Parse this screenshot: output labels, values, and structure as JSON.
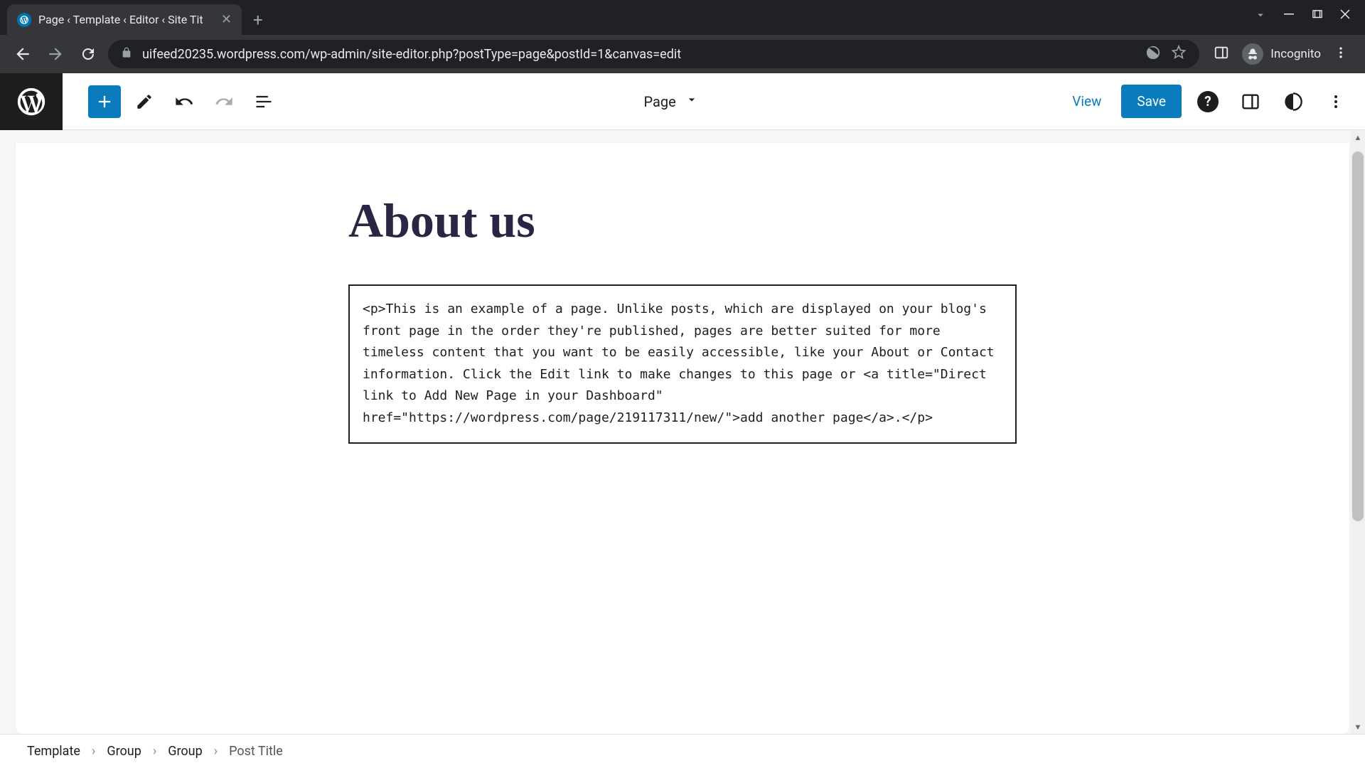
{
  "browser": {
    "tab_title": "Page ‹ Template ‹ Editor ‹ Site Tit",
    "url": "uifeed20235.wordpress.com/wp-admin/site-editor.php?postType=page&postId=1&canvas=edit",
    "incognito_label": "Incognito"
  },
  "toolbar": {
    "page_label": "Page",
    "view_label": "View",
    "save_label": "Save"
  },
  "content": {
    "title": "About us",
    "html_block": "<p>This is an example of a page. Unlike posts, which are displayed on your blog's front page in the order they're published, pages are better suited for more timeless content that you want to be easily accessible, like your About or Contact information. Click the Edit link to make changes to this page or <a title=\"Direct link to Add New Page in your Dashboard\" href=\"https://wordpress.com/page/219117311/new/\">add another page</a>.</p>"
  },
  "breadcrumbs": {
    "0": "Template",
    "1": "Group",
    "2": "Group",
    "3": "Post Title"
  }
}
